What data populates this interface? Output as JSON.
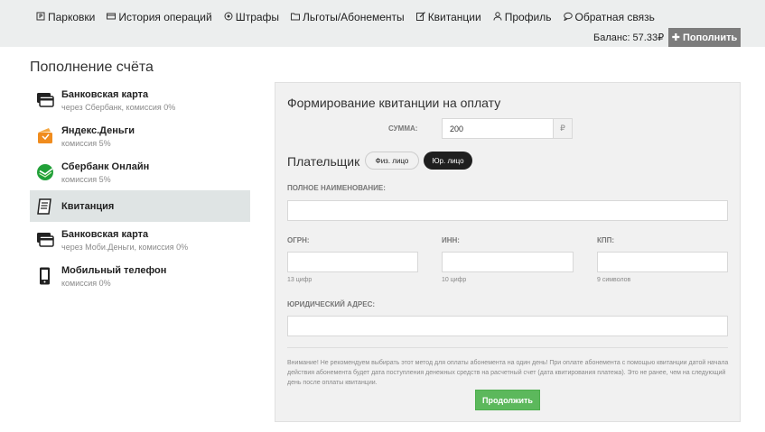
{
  "nav": {
    "items": [
      {
        "label": "Парковки",
        "icon": "parking-icon"
      },
      {
        "label": "История операций",
        "icon": "history-icon"
      },
      {
        "label": "Штрафы",
        "icon": "camera-icon"
      },
      {
        "label": "Льготы/Абонементы",
        "icon": "folder-icon"
      },
      {
        "label": "Квитанции",
        "icon": "edit-icon"
      },
      {
        "label": "Профиль",
        "icon": "user-icon"
      },
      {
        "label": "Обратная связь",
        "icon": "chat-icon"
      }
    ],
    "balance": "Баланс: 57.33₽",
    "topup_label": "Пополнить"
  },
  "page": {
    "title": "Пополнение счёта"
  },
  "methods": [
    {
      "title": "Банковская карта",
      "subtitle": "через Сбербанк, комиссия 0%",
      "icon": "bank-card-icon",
      "active": false
    },
    {
      "title": "Яндекс.Деньги",
      "subtitle": "комиссия 5%",
      "icon": "yandex-wallet-icon",
      "active": false
    },
    {
      "title": "Сбербанк Онлайн",
      "subtitle": "комиссия 5%",
      "icon": "sberbank-icon",
      "active": false
    },
    {
      "title": "Квитанция",
      "subtitle": "",
      "icon": "receipt-icon",
      "active": true
    },
    {
      "title": "Банковская карта",
      "subtitle": "через Моби.Деньги, комиссия 0%",
      "icon": "bank-card-icon",
      "active": false
    },
    {
      "title": "Мобильный телефон",
      "subtitle": "комиссия 0%",
      "icon": "mobile-phone-icon",
      "active": false
    }
  ],
  "form": {
    "title": "Формирование квитанции на оплату",
    "sum_label": "СУММА:",
    "sum_value": "200",
    "currency": "₽",
    "payer_label": "Плательщик",
    "payer_phys": "Физ. лицо",
    "payer_jur": "Юр. лицо",
    "full_name_label": "ПОЛНОЕ НАИМЕНОВАНИЕ:",
    "ogrn_label": "ОГРН:",
    "ogrn_hint": "13 цифр",
    "inn_label": "ИНН:",
    "inn_hint": "10 цифр",
    "kpp_label": "КПП:",
    "kpp_hint": "9 символов",
    "address_label": "ЮРИДИЧЕСКИЙ АДРЕС:",
    "notice": "Внимание! Не рекомендуем выбирать этот метод для оплаты абонемента на один день! При оплате абонемента с помощью квитанции датой начала действия абонемента будет дата поступления денежных средств на расчетный счет (дата квитирования платежа). Это не ранее, чем на следующий день после оплаты квитанции.",
    "continue_label": "Продолжить"
  },
  "colors": {
    "topbar_bg": "#eceeee",
    "active_method_bg": "#dfe4e4",
    "continue_green": "#5cb85c",
    "jur_toggle_bg": "#1f1f1f"
  }
}
